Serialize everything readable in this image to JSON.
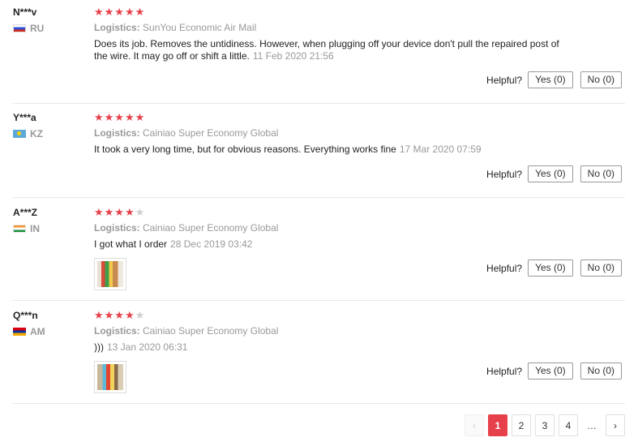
{
  "labels": {
    "logistics": "Logistics:",
    "helpful": "Helpful?"
  },
  "colors": {
    "star_active": "#e6404b",
    "star_inactive": "#cfcfcf",
    "active_page": "#e6404b"
  },
  "reviews": [
    {
      "user": "N***v",
      "country": "RU",
      "flag_icon": "russia-flag-icon",
      "rating": 5,
      "stars": "★★★★★",
      "stars_empty": "",
      "logistics": "SunYou Economic Air Mail",
      "text": "Does its job. Removes the untidiness. However, when plugging off your device don't pull the repaired post of the wire. It may go off or shift a little.",
      "date": "11 Feb 2020 21:56",
      "yes": "Yes (0)",
      "no": "No (0)"
    },
    {
      "user": "Y***a",
      "country": "KZ",
      "flag_icon": "kazakhstan-flag-icon",
      "rating": 5,
      "stars": "★★★★★",
      "stars_empty": "",
      "logistics": "Cainiao Super Economy Global",
      "text": "It took a very long time, but for obvious reasons. Everything works fine",
      "date": "17 Mar 2020 07:59",
      "yes": "Yes (0)",
      "no": "No (0)"
    },
    {
      "user": "A***Z",
      "country": "IN",
      "flag_icon": "india-flag-icon",
      "rating": 4,
      "stars": "★★★★",
      "stars_empty": "★",
      "logistics": "Cainiao Super Economy Global",
      "text": "I got what I order",
      "date": "28 Dec 2019 03:42",
      "photo_icon": "review-photo-thumbnail",
      "yes": "Yes (0)",
      "no": "No (0)"
    },
    {
      "user": "Q***n",
      "country": "AM",
      "flag_icon": "armenia-flag-icon",
      "rating": 4,
      "stars": "★★★★",
      "stars_empty": "★",
      "logistics": "Cainiao Super Economy Global",
      "text": ")))",
      "date": "13 Jan 2020 06:31",
      "photo_icon": "review-photo-thumbnail",
      "yes": "Yes (0)",
      "no": "No (0)"
    }
  ],
  "pagination": {
    "prev": "‹",
    "pages": [
      "1",
      "2",
      "3",
      "4"
    ],
    "current": "1",
    "ellipsis": "…",
    "next": "›"
  }
}
